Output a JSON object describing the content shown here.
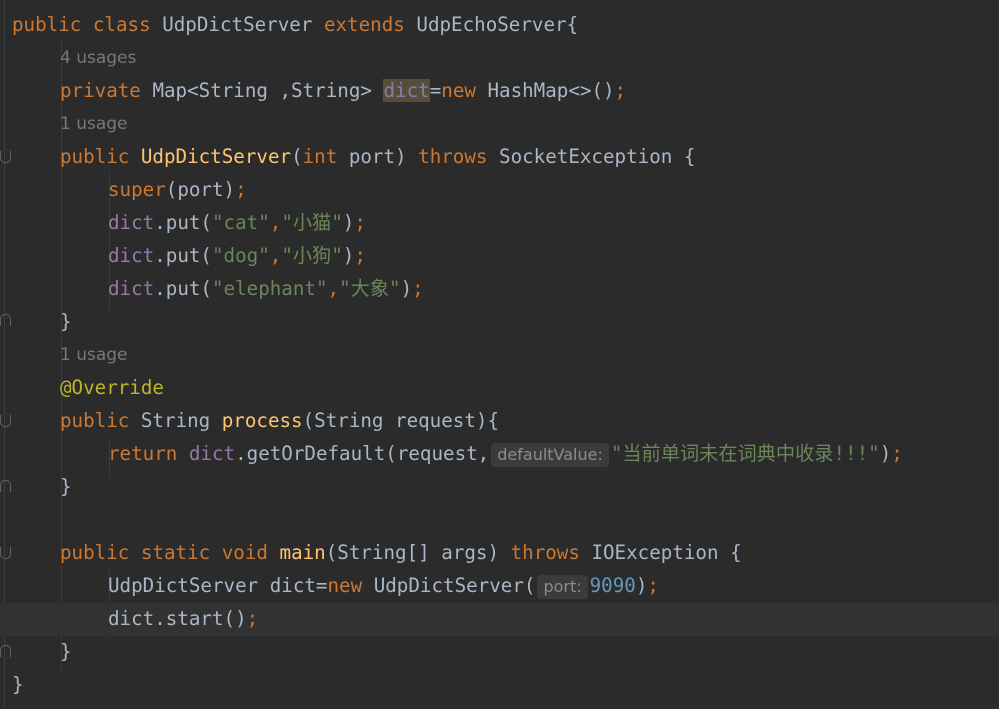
{
  "lines": {
    "l1": {
      "kw1": "public",
      "kw2": "class",
      "name": "UdpDictServer",
      "kw3": "extends",
      "parent": "UdpEchoServer",
      "brace": "{"
    },
    "u1": "4 usages",
    "l2": {
      "kw1": "private",
      "type": "Map<String ,String> ",
      "field": "dict",
      "eq": "=",
      "kw2": "new",
      "ctor": " HashMap<>()",
      "semi": ";"
    },
    "u2": "1 usage",
    "l3": {
      "kw1": "public",
      "name": "UdpDictServer",
      "lp": "(",
      "kw2": "int",
      "mid": " port) ",
      "kw3": "throws",
      "exc": " SocketException {"
    },
    "l4": {
      "kw1": "super",
      "rest": "(port)",
      "semi": ";"
    },
    "l5": {
      "field": "dict",
      "call": ".put(",
      "s1": "\"cat\"",
      "comma": ",",
      "s2": "\"小猫\"",
      "close": ")",
      "semi": ";"
    },
    "l6": {
      "field": "dict",
      "call": ".put(",
      "s1": "\"dog\"",
      "comma": ",",
      "s2": "\"小狗\"",
      "close": ")",
      "semi": ";"
    },
    "l7": {
      "field": "dict",
      "call": ".put(",
      "s1": "\"elephant\"",
      "comma": ",",
      "s2": "\"大象\"",
      "close": ")",
      "semi": ";"
    },
    "l8": "}",
    "u3": "1 usage",
    "l9": "@Override",
    "l10": {
      "kw1": "public",
      "type": " String ",
      "name": "process",
      "rest": "(String request){"
    },
    "l11": {
      "kw1": "return",
      "field": "dict",
      "call": ".getOrDefault(request,",
      "hint": "defaultValue:",
      "s1": "\"当前单词未在词典中收录!!!\"",
      "close": ")",
      "semi": ";"
    },
    "l12": "}",
    "l13": {
      "kw1": "public",
      "kw2": "static",
      "kw3": "void",
      "name": "main",
      "mid": "(String[] args) ",
      "kw4": "throws",
      "exc": " IOException {"
    },
    "l14": {
      "pre": "UdpDictServer dict=",
      "kw1": "new",
      "ctor": " UdpDictServer(",
      "hint": "port:",
      "num": "9090",
      "close": ")",
      "semi": ";"
    },
    "l15": {
      "call": "dict.start()",
      "semi": ";"
    },
    "l16": "}",
    "l17": "}"
  }
}
